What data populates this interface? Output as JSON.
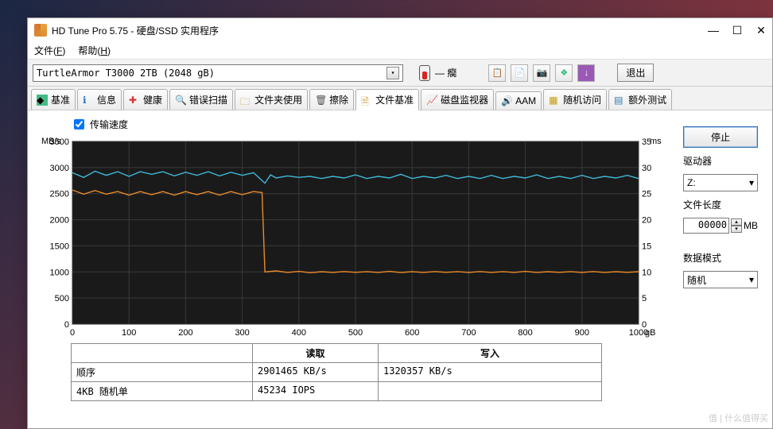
{
  "window": {
    "title": "HD Tune Pro 5.75 - 硬盘/SSD 实用程序"
  },
  "menu": {
    "file": "文件",
    "file_u": "F",
    "help": "帮助",
    "help_u": "H"
  },
  "toolbar": {
    "drive": "TurtleArmor T3000 2TB (2048 gB)",
    "temp_label": "— 癵",
    "exit": "退出"
  },
  "tabs": {
    "bench": "基准",
    "info": "信息",
    "health": "健康",
    "errscan": "错误扫描",
    "folder": "文件夹使用",
    "erase": "擦除",
    "filebench": "文件基准",
    "diskmon": "磁盘监视器",
    "aam": "AAM",
    "random": "随机访问",
    "extra": "额外测试"
  },
  "content": {
    "checkbox_label": "传输速度",
    "ylabel_left": "MB/s",
    "ylabel_right": "ms",
    "table": {
      "h_read": "读取",
      "h_write": "写入",
      "r1": "顺序",
      "r1_read": "2901465 KB/s",
      "r1_write": "1320357 KB/s",
      "r2": "4KB 随机单",
      "r2_read": "45234 IOPS"
    }
  },
  "side": {
    "stop": "停止",
    "drive_label": "驱动器",
    "drive_value": "Z:",
    "filelen": "文件长度",
    "filelen_value": "00000",
    "filelen_unit": "MB",
    "pattern_label": "数据模式",
    "pattern_value": "随机"
  },
  "chart_data": {
    "type": "line",
    "xlabel": "gB",
    "xlim": [
      0,
      1000
    ],
    "xstep": 100,
    "ylabel_left": "MB/s",
    "ylim_left": [
      0,
      3500
    ],
    "ystep_left": 500,
    "ylabel_right": "ms",
    "ylim_right": [
      0,
      35
    ],
    "ystep_right": 5,
    "series": [
      {
        "name": "read",
        "color": "#3fb8d8",
        "values": [
          [
            0,
            2900
          ],
          [
            20,
            2810
          ],
          [
            40,
            2930
          ],
          [
            60,
            2850
          ],
          [
            80,
            2920
          ],
          [
            100,
            2830
          ],
          [
            120,
            2920
          ],
          [
            140,
            2870
          ],
          [
            160,
            2920
          ],
          [
            180,
            2840
          ],
          [
            200,
            2910
          ],
          [
            220,
            2850
          ],
          [
            240,
            2920
          ],
          [
            260,
            2840
          ],
          [
            280,
            2910
          ],
          [
            300,
            2850
          ],
          [
            320,
            2900
          ],
          [
            340,
            2700
          ],
          [
            350,
            2860
          ],
          [
            360,
            2800
          ],
          [
            380,
            2840
          ],
          [
            400,
            2810
          ],
          [
            420,
            2830
          ],
          [
            440,
            2790
          ],
          [
            460,
            2830
          ],
          [
            480,
            2800
          ],
          [
            500,
            2860
          ],
          [
            520,
            2790
          ],
          [
            540,
            2830
          ],
          [
            560,
            2800
          ],
          [
            580,
            2870
          ],
          [
            600,
            2790
          ],
          [
            620,
            2830
          ],
          [
            640,
            2800
          ],
          [
            660,
            2850
          ],
          [
            680,
            2790
          ],
          [
            700,
            2830
          ],
          [
            720,
            2790
          ],
          [
            740,
            2850
          ],
          [
            760,
            2790
          ],
          [
            780,
            2830
          ],
          [
            800,
            2800
          ],
          [
            820,
            2860
          ],
          [
            840,
            2790
          ],
          [
            860,
            2830
          ],
          [
            880,
            2790
          ],
          [
            900,
            2850
          ],
          [
            920,
            2790
          ],
          [
            940,
            2830
          ],
          [
            960,
            2800
          ],
          [
            980,
            2850
          ],
          [
            1000,
            2790
          ]
        ]
      },
      {
        "name": "write",
        "color": "#e88a2c",
        "values": [
          [
            0,
            2570
          ],
          [
            20,
            2490
          ],
          [
            40,
            2560
          ],
          [
            60,
            2490
          ],
          [
            80,
            2540
          ],
          [
            100,
            2470
          ],
          [
            120,
            2540
          ],
          [
            140,
            2480
          ],
          [
            160,
            2540
          ],
          [
            180,
            2470
          ],
          [
            200,
            2540
          ],
          [
            220,
            2480
          ],
          [
            240,
            2540
          ],
          [
            260,
            2470
          ],
          [
            280,
            2540
          ],
          [
            300,
            2480
          ],
          [
            320,
            2540
          ],
          [
            335,
            2520
          ],
          [
            340,
            1000
          ],
          [
            360,
            1020
          ],
          [
            380,
            990
          ],
          [
            400,
            1010
          ],
          [
            420,
            985
          ],
          [
            440,
            1005
          ],
          [
            460,
            990
          ],
          [
            480,
            1008
          ],
          [
            500,
            992
          ],
          [
            520,
            1006
          ],
          [
            540,
            990
          ],
          [
            560,
            1010
          ],
          [
            580,
            988
          ],
          [
            600,
            1006
          ],
          [
            620,
            990
          ],
          [
            640,
            1008
          ],
          [
            660,
            992
          ],
          [
            680,
            1006
          ],
          [
            700,
            990
          ],
          [
            720,
            1008
          ],
          [
            740,
            990
          ],
          [
            760,
            1006
          ],
          [
            780,
            990
          ],
          [
            800,
            1010
          ],
          [
            820,
            990
          ],
          [
            840,
            1005
          ],
          [
            860,
            992
          ],
          [
            880,
            1006
          ],
          [
            900,
            990
          ],
          [
            920,
            1008
          ],
          [
            940,
            990
          ],
          [
            960,
            1005
          ],
          [
            980,
            992
          ],
          [
            1000,
            1005
          ]
        ]
      }
    ]
  },
  "watermark": "值 | 什么值得买"
}
